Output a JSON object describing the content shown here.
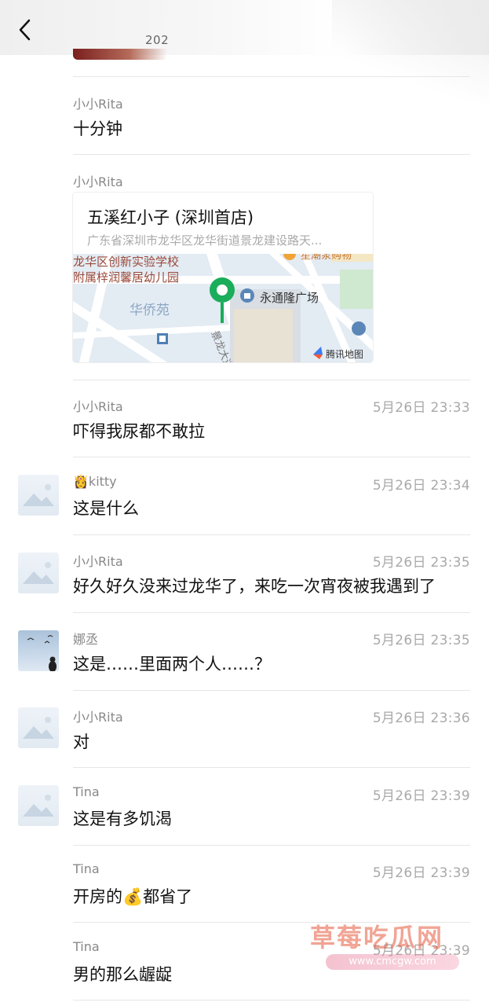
{
  "header": {
    "date_partial": "202"
  },
  "location": {
    "sender": "小小Rita",
    "title": "五溪红小子 (深圳首店)",
    "address": "广东省深圳市龙华区龙华街道景龙建设路天...",
    "map_labels": {
      "school_line1": "龙华区创新实验学校",
      "school_line2": "附属梓润馨居幼儿园",
      "district": "华侨苑",
      "plaza": "永通隆广场",
      "road": "景龙大道",
      "shop": "星潮泵购物",
      "provider": "腾讯地图"
    }
  },
  "messages": [
    {
      "sender": "小小Rita",
      "time": "",
      "text": "十分钟",
      "avatar": "none"
    },
    {
      "sender": "小小Rita",
      "time": "5月26日 23:33",
      "text": "吓得我尿都不敢拉",
      "avatar": "none"
    },
    {
      "sender": "kitty",
      "sender_emoji": "👸",
      "time": "5月26日 23:34",
      "text": "这是什么",
      "avatar": "placeholder"
    },
    {
      "sender": "小小Rita",
      "time": "5月26日 23:35",
      "text": "好久好久没来过龙华了，来吃一次宵夜被我遇到了",
      "avatar": "placeholder"
    },
    {
      "sender": "娜丞",
      "time": "5月26日 23:35",
      "text": "这是……里面两个人……？",
      "avatar": "photo"
    },
    {
      "sender": "小小Rita",
      "time": "5月26日 23:36",
      "text": "对",
      "avatar": "placeholder"
    },
    {
      "sender": "Tina",
      "time": "5月26日 23:39",
      "text": "这是有多饥渴",
      "avatar": "placeholder"
    },
    {
      "sender": "Tina",
      "time": "5月26日 23:39",
      "text": "开房的💰都省了",
      "avatar": "none"
    },
    {
      "sender": "Tina",
      "time": "5月26日 23:39",
      "text": "男的那么龌龊",
      "avatar": "none"
    }
  ],
  "watermark": {
    "text": "草莓吃瓜网",
    "url": "www.cmcgw.com"
  },
  "colors": {
    "divider": "#e6e6e6",
    "pin": "#1aad5a",
    "time": "#a9a9a9"
  }
}
